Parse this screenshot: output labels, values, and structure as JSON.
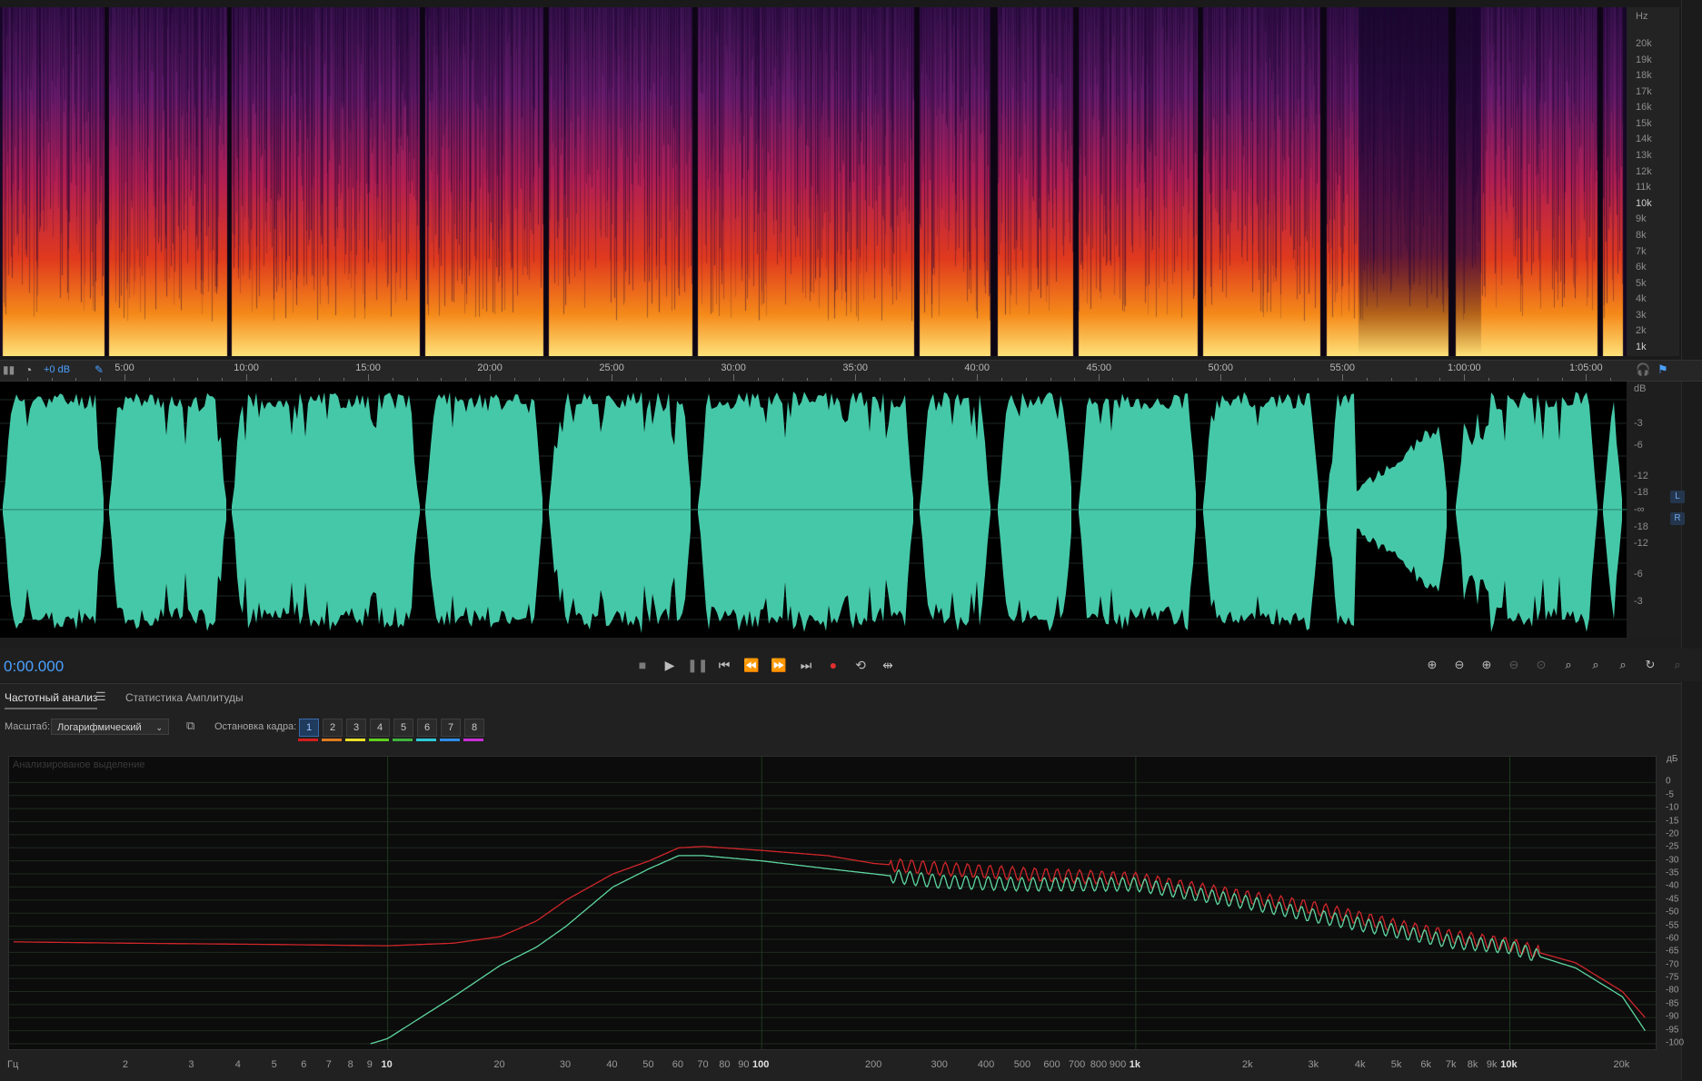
{
  "spectral": {
    "hz_unit": "Hz",
    "hz_labels": [
      {
        "label": "20k",
        "v": 20000
      },
      {
        "label": "19k",
        "v": 19000
      },
      {
        "label": "18k",
        "v": 18000
      },
      {
        "label": "17k",
        "v": 17000
      },
      {
        "label": "16k",
        "v": 16000
      },
      {
        "label": "15k",
        "v": 15000
      },
      {
        "label": "14k",
        "v": 14000
      },
      {
        "label": "13k",
        "v": 13000
      },
      {
        "label": "12k",
        "v": 12000
      },
      {
        "label": "11k",
        "v": 11000
      },
      {
        "label": "10k",
        "v": 10000
      },
      {
        "label": "9k",
        "v": 9000
      },
      {
        "label": "8k",
        "v": 8000
      },
      {
        "label": "7k",
        "v": 7000
      },
      {
        "label": "6k",
        "v": 6000
      },
      {
        "label": "5k",
        "v": 5000
      },
      {
        "label": "4k",
        "v": 4000
      },
      {
        "label": "3k",
        "v": 3000
      },
      {
        "label": "2k",
        "v": 2000
      },
      {
        "label": "1k",
        "v": 1000
      }
    ]
  },
  "timeline": {
    "gain": "+0 dB",
    "ticks": [
      {
        "label": "5:00",
        "t": 300
      },
      {
        "label": "10:00",
        "t": 600
      },
      {
        "label": "15:00",
        "t": 900
      },
      {
        "label": "20:00",
        "t": 1200
      },
      {
        "label": "25:00",
        "t": 1500
      },
      {
        "label": "30:00",
        "t": 1800
      },
      {
        "label": "35:00",
        "t": 2100
      },
      {
        "label": "40:00",
        "t": 2400
      },
      {
        "label": "45:00",
        "t": 2700
      },
      {
        "label": "50:00",
        "t": 3000
      },
      {
        "label": "55:00",
        "t": 3300
      },
      {
        "label": "1:00:00",
        "t": 3600
      },
      {
        "label": "1:05:00",
        "t": 3900
      }
    ]
  },
  "waveform": {
    "db_unit": "dB",
    "db_labels": [
      "-3",
      "-6",
      "-12",
      "-18",
      "-∞",
      "-18",
      "-12",
      "-6",
      "-3"
    ],
    "channels": [
      "L",
      "R"
    ],
    "color": "#45c8a8"
  },
  "transport": {
    "time": "0:00.000"
  },
  "panel": {
    "tabs": [
      "Частотный анализ",
      "Статистика Амплитуды"
    ],
    "scale_label": "Масштаб:",
    "scale_value": "Логарифмический",
    "freeze_label": "Остановка кадра:",
    "frames": [
      "1",
      "2",
      "3",
      "4",
      "5",
      "6",
      "7",
      "8"
    ],
    "frame_colors": [
      "#d21e1e",
      "#e07b1f",
      "#e8e02a",
      "#5fd11f",
      "#3fb33f",
      "#2ec9d6",
      "#2f8de8",
      "#c72fd6"
    ],
    "graph_legend": "Анализированое выделение"
  },
  "chart_data": {
    "type": "line",
    "xscale": "log",
    "xlabel": "Гц",
    "ylabel": "дБ",
    "xlim": [
      1,
      24000
    ],
    "ylim": [
      -100,
      5
    ],
    "x_ticks": [
      {
        "label": "2",
        "v": 2
      },
      {
        "label": "3",
        "v": 3
      },
      {
        "label": "4",
        "v": 4
      },
      {
        "label": "5",
        "v": 5
      },
      {
        "label": "6",
        "v": 6
      },
      {
        "label": "7",
        "v": 7
      },
      {
        "label": "8",
        "v": 8
      },
      {
        "label": "9",
        "v": 9
      },
      {
        "label": "10",
        "v": 10
      },
      {
        "label": "20",
        "v": 20
      },
      {
        "label": "30",
        "v": 30
      },
      {
        "label": "40",
        "v": 40
      },
      {
        "label": "50",
        "v": 50
      },
      {
        "label": "60",
        "v": 60
      },
      {
        "label": "70",
        "v": 70
      },
      {
        "label": "80",
        "v": 80
      },
      {
        "label": "90",
        "v": 90
      },
      {
        "label": "100",
        "v": 100
      },
      {
        "label": "200",
        "v": 200
      },
      {
        "label": "300",
        "v": 300
      },
      {
        "label": "400",
        "v": 400
      },
      {
        "label": "500",
        "v": 500
      },
      {
        "label": "600",
        "v": 600
      },
      {
        "label": "700",
        "v": 700
      },
      {
        "label": "800",
        "v": 800
      },
      {
        "label": "900",
        "v": 900
      },
      {
        "label": "1k",
        "v": 1000
      },
      {
        "label": "2k",
        "v": 2000
      },
      {
        "label": "3k",
        "v": 3000
      },
      {
        "label": "4k",
        "v": 4000
      },
      {
        "label": "5k",
        "v": 5000
      },
      {
        "label": "6k",
        "v": 6000
      },
      {
        "label": "7k",
        "v": 7000
      },
      {
        "label": "8k",
        "v": 8000
      },
      {
        "label": "9k",
        "v": 9000
      },
      {
        "label": "10k",
        "v": 10000
      },
      {
        "label": "20k",
        "v": 20000
      }
    ],
    "y_ticks": [
      0,
      -5,
      -10,
      -15,
      -20,
      -25,
      -30,
      -35,
      -40,
      -45,
      -50,
      -55,
      -60,
      -65,
      -70,
      -75,
      -80,
      -85,
      -90,
      -95,
      -100
    ],
    "series": [
      {
        "color": "#d0262a",
        "x": [
          1,
          2,
          5,
          10,
          15,
          20,
          25,
          30,
          40,
          50,
          60,
          70,
          100,
          150,
          200,
          300,
          500,
          1000,
          2000,
          3000,
          5000,
          7000,
          10000,
          15000,
          20000,
          23000
        ],
        "y": [
          -61,
          -61.5,
          -62,
          -62.5,
          -61.5,
          -59,
          -53,
          -45,
          -35,
          -30,
          -25,
          -24.5,
          -26,
          -28,
          -31,
          -33,
          -35,
          -37,
          -44,
          -48,
          -55,
          -59,
          -62,
          -69,
          -80,
          -90
        ]
      },
      {
        "color": "#5ed6a0",
        "x": [
          9,
          10,
          15,
          20,
          25,
          30,
          40,
          50,
          60,
          70,
          100,
          150,
          200,
          300,
          500,
          1000,
          2000,
          3000,
          5000,
          7000,
          10000,
          15000,
          20000,
          23000
        ],
        "y": [
          -100,
          -98,
          -82,
          -70,
          -63,
          -55,
          -40,
          -33,
          -28,
          -28,
          -30,
          -33,
          -35,
          -38,
          -39,
          -39,
          -46,
          -51,
          -57,
          -61,
          -63,
          -71,
          -82,
          -95
        ]
      }
    ]
  }
}
